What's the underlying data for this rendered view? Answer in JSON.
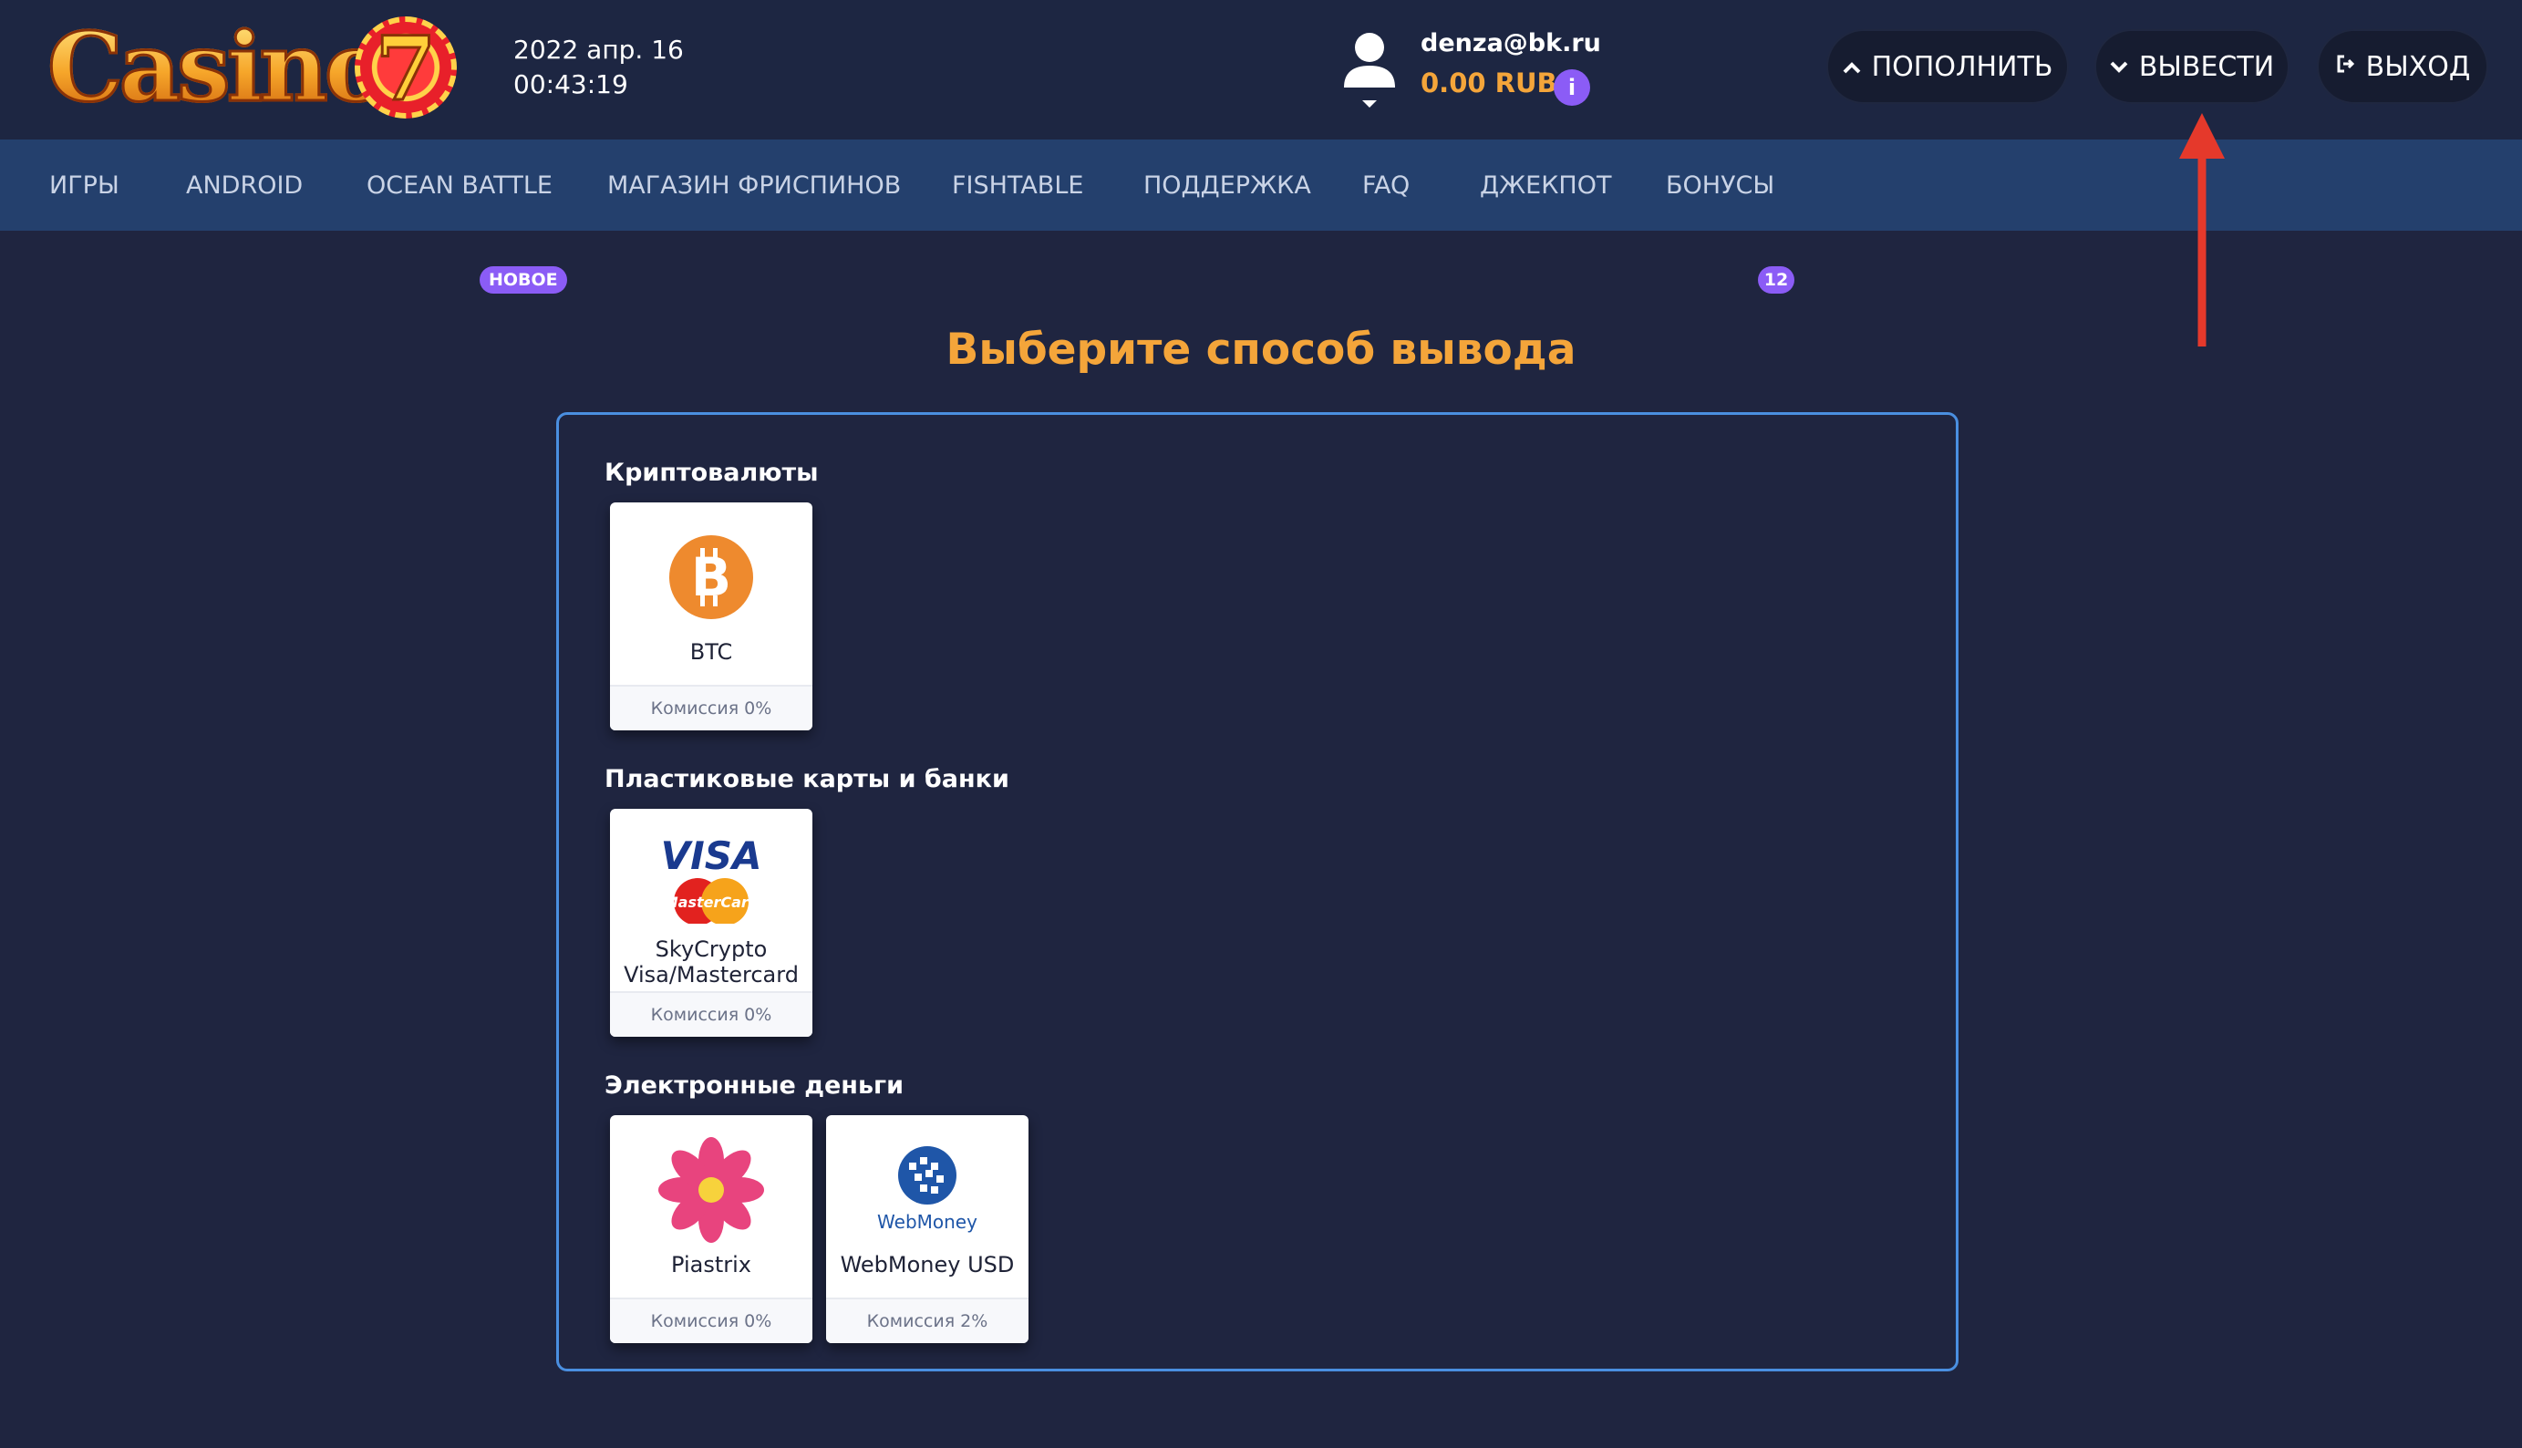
{
  "header": {
    "logo": "Casino7",
    "date": "2022 апр. 16",
    "time": "00:43:19",
    "user_email": "denza@bk.ru",
    "balance": "0.00 RUB",
    "info_label": "i",
    "deposit_label": "ПОПОЛНИТЬ",
    "withdraw_label": "ВЫВЕСТИ",
    "exit_label": "ВЫХОД",
    "deposit_icon": "chevron-up-icon",
    "withdraw_icon": "chevron-down-icon",
    "exit_icon": "logout-icon"
  },
  "nav": {
    "items": [
      {
        "label": "ИГРЫ"
      },
      {
        "label": "ANDROID"
      },
      {
        "label": "OCEAN BATTLE",
        "badge": "НОВОЕ"
      },
      {
        "label": "МАГАЗИН ФРИСПИНОВ"
      },
      {
        "label": "FISHTABLE"
      },
      {
        "label": "ПОДДЕРЖКА"
      },
      {
        "label": "FAQ"
      },
      {
        "label": "ДЖЕКПОТ"
      },
      {
        "label": "БОНУСЫ",
        "badge": "12"
      }
    ]
  },
  "main": {
    "title": "Выберите способ вывода",
    "sections": [
      {
        "title": "Криптовалюты",
        "methods": [
          {
            "name": "BTC",
            "fee": "Комиссия 0%",
            "icon": "bitcoin-icon"
          }
        ]
      },
      {
        "title": "Пластиковые карты и банки",
        "methods": [
          {
            "name_line1": "SkyCrypto",
            "name_line2": "Visa/Mastercard",
            "fee": "Комиссия 0%",
            "icon": "visa-mastercard-icon",
            "visa_text": "VISA",
            "mc_text": "MasterCard"
          }
        ]
      },
      {
        "title": "Электронные деньги",
        "methods": [
          {
            "name": "Piastrix",
            "fee": "Комиссия 0%",
            "icon": "piastrix-flower-icon"
          },
          {
            "name": "WebMoney USD",
            "fee": "Комиссия 2%",
            "icon": "webmoney-icon",
            "logo_text": "WebMoney"
          }
        ]
      }
    ]
  },
  "colors": {
    "background": "#1f2540",
    "nav": "#24406d",
    "accent": "#f4a53a",
    "badge": "#8b5cf6",
    "panel_border": "#4a8fe0",
    "annotation_arrow": "#e5392b"
  }
}
